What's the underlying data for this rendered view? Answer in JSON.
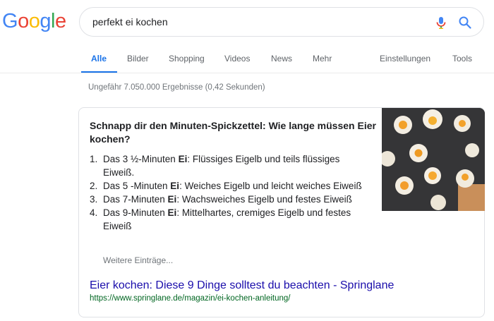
{
  "logo": {
    "letters": [
      "G",
      "o",
      "o",
      "g",
      "l",
      "e"
    ],
    "colors": [
      "#4285F4",
      "#EA4335",
      "#FBBC05",
      "#4285F4",
      "#34A853",
      "#EA4335"
    ]
  },
  "search": {
    "query": "perfekt ei kochen"
  },
  "tabs": {
    "items": [
      {
        "label": "Alle",
        "active": true
      },
      {
        "label": "Bilder"
      },
      {
        "label": "Shopping"
      },
      {
        "label": "Videos"
      },
      {
        "label": "News"
      },
      {
        "label": "Mehr"
      }
    ],
    "settings": "Einstellungen",
    "tools": "Tools"
  },
  "stats": "Ungefähr 7.050.000 Ergebnisse (0,42 Sekunden)",
  "snippet": {
    "title": "Schnapp dir den Minuten-Spickzettel: Wie lange müssen Eier kochen?",
    "steps": [
      {
        "num": "1.",
        "pre": "Das 3 ½-Minuten ",
        "bold": "Ei",
        "post": ": Flüssiges Eigelb und teils flüssiges Eiweiß."
      },
      {
        "num": "2.",
        "pre": "Das 5 -Minuten ",
        "bold": "Ei",
        "post": ": Weiches Eigelb und leicht weiches Eiweiß"
      },
      {
        "num": "3.",
        "pre": "Das 7-Minuten ",
        "bold": "Ei",
        "post": ": Wachsweiches Eigelb und festes Eiweiß"
      },
      {
        "num": "4.",
        "pre": "Das 9-Minuten ",
        "bold": "Ei",
        "post": ": Mittelhartes, cremiges Eigelb und festes Eiweiß"
      }
    ],
    "more": "Weitere Einträge...",
    "result_title": "Eier kochen: Diese 9 Dinge solltest du beachten - Springlane",
    "result_url": "https://www.springlane.de/magazin/ei-kochen-anleitung/",
    "image_icon": "boiled-eggs-photo"
  }
}
